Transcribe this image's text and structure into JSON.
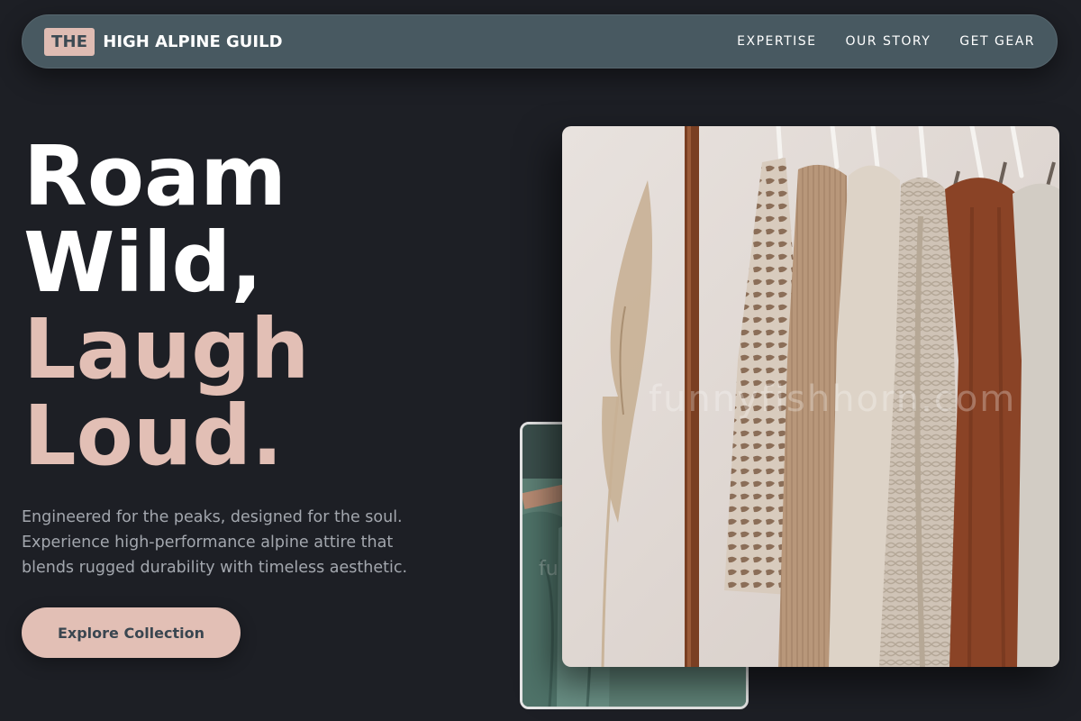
{
  "nav": {
    "brand_badge": "THE",
    "brand_name": "HIGH ALPINE GUILD",
    "links": [
      "EXPERTISE",
      "OUR STORY",
      "GET GEAR"
    ]
  },
  "hero": {
    "title_line1": "Roam",
    "title_line2": "Wild,",
    "title_line3": "Laugh",
    "title_line4": "Loud.",
    "description": "Engineered for the peaks, designed for the soul. Experience high-performance alpine attire that blends rugged durability with timeless aesthetic.",
    "cta_label": "Explore Collection"
  },
  "images": {
    "main_watermark": "funnyfishhorn.com",
    "back_watermark": "fu"
  },
  "colors": {
    "background": "#1d1f25",
    "nav_background": "#485961",
    "accent": "#e2bfb5",
    "text_primary": "#ffffff",
    "text_muted": "#a3a7ae"
  }
}
